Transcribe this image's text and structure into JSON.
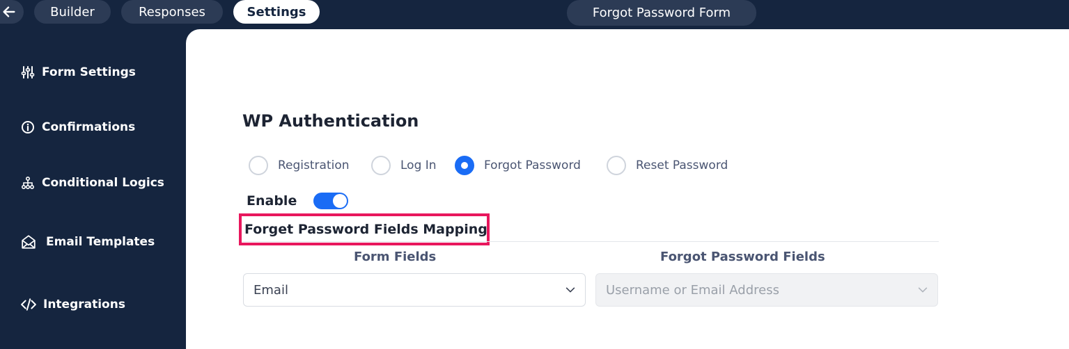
{
  "topbar": {
    "back_icon": "arrow-left-icon",
    "tabs": [
      {
        "label": "Builder",
        "active": false
      },
      {
        "label": "Responses",
        "active": false
      },
      {
        "label": "Settings",
        "active": true
      }
    ],
    "form_title": "Forgot Password Form"
  },
  "sidebar": {
    "items": [
      {
        "label": "Form Settings",
        "icon": "sliders-icon"
      },
      {
        "label": "Confirmations",
        "icon": "info-circle-icon"
      },
      {
        "label": "Conditional Logics",
        "icon": "sitemap-icon"
      },
      {
        "label": "Email Templates",
        "icon": "envelope-open-icon"
      },
      {
        "label": "Integrations",
        "icon": "code-icon"
      }
    ]
  },
  "main": {
    "section_title": "WP Authentication",
    "radios": [
      {
        "label": "Registration",
        "checked": false
      },
      {
        "label": "Log In",
        "checked": false
      },
      {
        "label": "Forgot Password",
        "checked": true
      },
      {
        "label": "Reset Password",
        "checked": false
      }
    ],
    "enable_label": "Enable",
    "enable_on": true,
    "mapping_heading": "Forget Password Fields Mapping",
    "columns": {
      "form_fields": "Form Fields",
      "forgot_password_fields": "Forgot Password Fields"
    },
    "form_field_value": "Email",
    "forgot_field_placeholder": "Username or Email Address"
  },
  "colors": {
    "navy": "#15253f",
    "accent_blue": "#1a6cf5",
    "highlight_pink": "#e8175d"
  }
}
